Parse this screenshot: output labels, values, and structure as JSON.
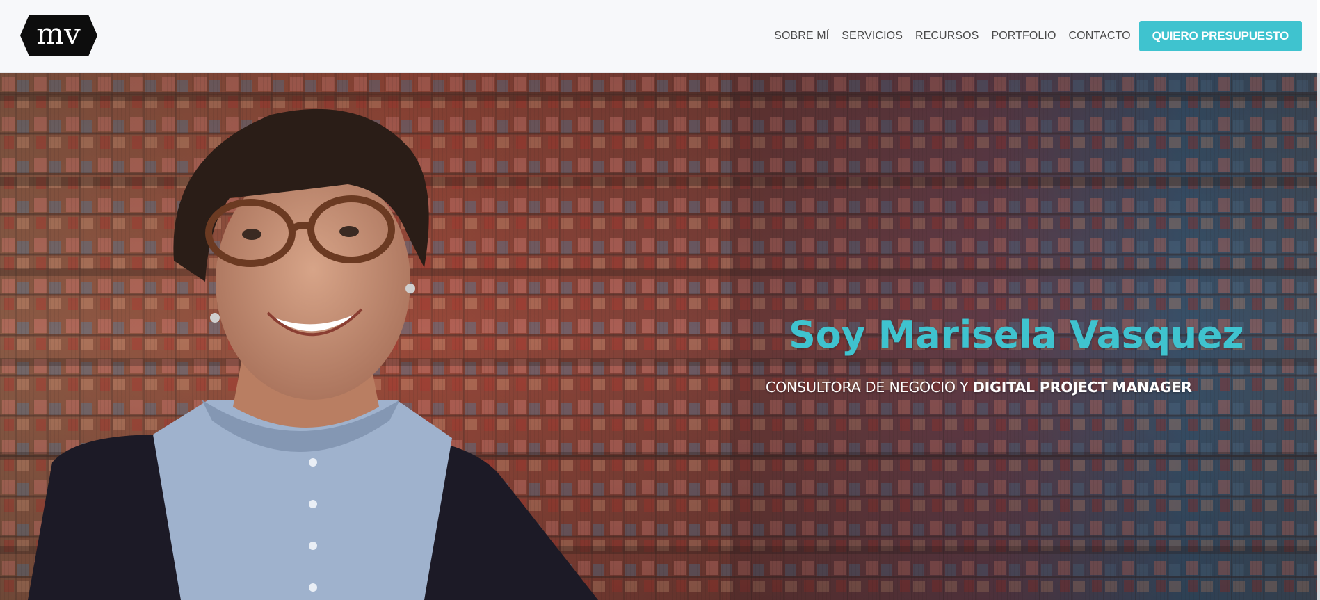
{
  "header": {
    "logo_text": "mv",
    "nav": [
      {
        "label": "SOBRE MÍ"
      },
      {
        "label": "SERVICIOS"
      },
      {
        "label": "RECURSOS"
      },
      {
        "label": "PORTFOLIO"
      },
      {
        "label": "CONTACTO"
      }
    ],
    "cta_label": "QUIERO PRESUPUESTO"
  },
  "hero": {
    "title": "Soy Marisela Vasquez",
    "subtitle_regular": "CONSULTORA DE NEGOCIO Y ",
    "subtitle_bold": "DIGITAL PROJECT MANAGER"
  },
  "colors": {
    "accent": "#3fc3cf",
    "header_bg": "#f7f8fa",
    "nav_text": "#4a4a4a"
  },
  "icons": {
    "logo": "mv-hexagon-logo"
  }
}
